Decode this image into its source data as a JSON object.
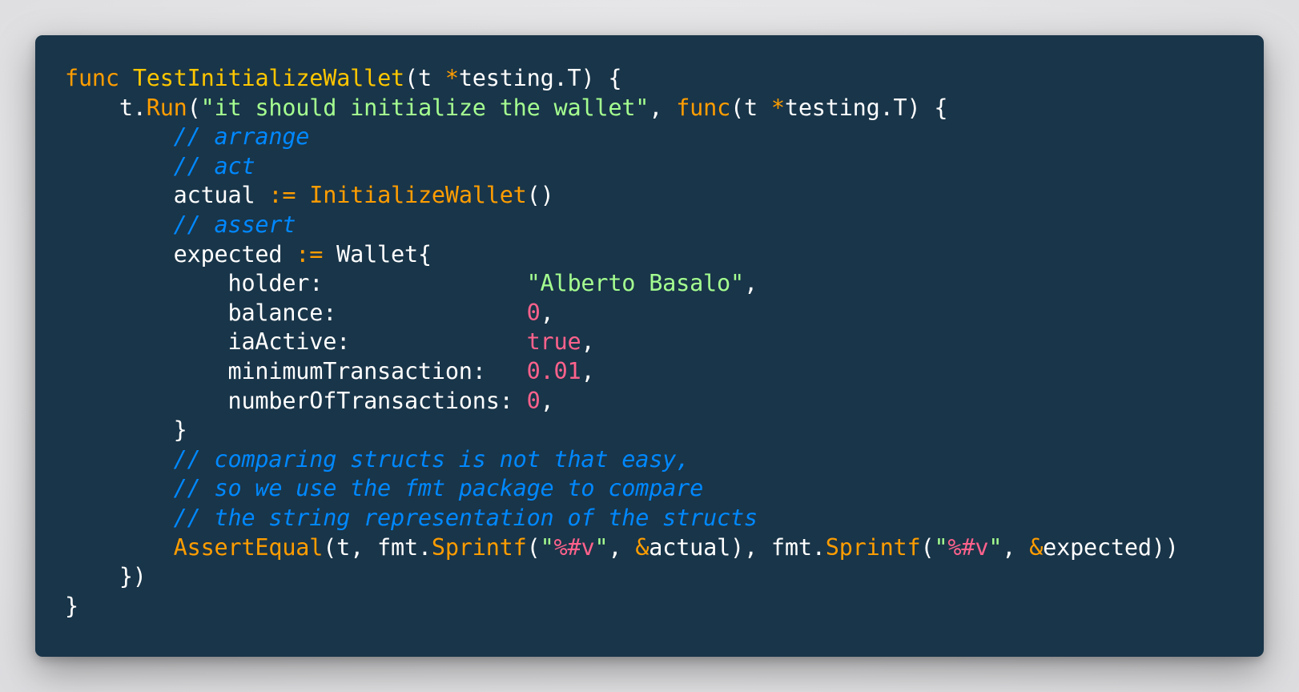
{
  "colors": {
    "background": "#193549",
    "keyword": "#ff9d00",
    "function_name": "#ffc600",
    "string": "#a5ff90",
    "number": "#ff628c",
    "comment": "#0088ff",
    "plain": "#ffffff"
  },
  "lines": [
    {
      "tokens": [
        {
          "t": "func",
          "c": "kw"
        },
        {
          "t": " ",
          "c": "pl"
        },
        {
          "t": "TestInitializeWallet",
          "c": "fn"
        },
        {
          "t": "(t ",
          "c": "pl"
        },
        {
          "t": "*",
          "c": "op"
        },
        {
          "t": "testing.T) {",
          "c": "pl"
        }
      ]
    },
    {
      "tokens": [
        {
          "t": "    t.",
          "c": "pl"
        },
        {
          "t": "Run",
          "c": "call"
        },
        {
          "t": "(",
          "c": "pl"
        },
        {
          "t": "\"it should initialize the wallet\"",
          "c": "str"
        },
        {
          "t": ", ",
          "c": "pl"
        },
        {
          "t": "func",
          "c": "kw"
        },
        {
          "t": "(t ",
          "c": "pl"
        },
        {
          "t": "*",
          "c": "op"
        },
        {
          "t": "testing.T) {",
          "c": "pl"
        }
      ]
    },
    {
      "tokens": [
        {
          "t": "        ",
          "c": "pl"
        },
        {
          "t": "// arrange",
          "c": "cm"
        }
      ]
    },
    {
      "tokens": [
        {
          "t": "        ",
          "c": "pl"
        },
        {
          "t": "// act",
          "c": "cm"
        }
      ]
    },
    {
      "tokens": [
        {
          "t": "        actual ",
          "c": "pl"
        },
        {
          "t": ":=",
          "c": "op"
        },
        {
          "t": " ",
          "c": "pl"
        },
        {
          "t": "InitializeWallet",
          "c": "call"
        },
        {
          "t": "()",
          "c": "pl"
        }
      ]
    },
    {
      "tokens": [
        {
          "t": "        ",
          "c": "pl"
        },
        {
          "t": "// assert",
          "c": "cm"
        }
      ]
    },
    {
      "tokens": [
        {
          "t": "        expected ",
          "c": "pl"
        },
        {
          "t": ":=",
          "c": "op"
        },
        {
          "t": " Wallet{",
          "c": "pl"
        }
      ]
    },
    {
      "tokens": [
        {
          "t": "            holder:               ",
          "c": "pl"
        },
        {
          "t": "\"Alberto Basalo\"",
          "c": "str"
        },
        {
          "t": ",",
          "c": "pl"
        }
      ]
    },
    {
      "tokens": [
        {
          "t": "            balance:              ",
          "c": "pl"
        },
        {
          "t": "0",
          "c": "num"
        },
        {
          "t": ",",
          "c": "pl"
        }
      ]
    },
    {
      "tokens": [
        {
          "t": "            iaActive:             ",
          "c": "pl"
        },
        {
          "t": "true",
          "c": "num"
        },
        {
          "t": ",",
          "c": "pl"
        }
      ]
    },
    {
      "tokens": [
        {
          "t": "            minimumTransaction:   ",
          "c": "pl"
        },
        {
          "t": "0.01",
          "c": "num"
        },
        {
          "t": ",",
          "c": "pl"
        }
      ]
    },
    {
      "tokens": [
        {
          "t": "            numberOfTransactions: ",
          "c": "pl"
        },
        {
          "t": "0",
          "c": "num"
        },
        {
          "t": ",",
          "c": "pl"
        }
      ]
    },
    {
      "tokens": [
        {
          "t": "        }",
          "c": "pl"
        }
      ]
    },
    {
      "tokens": [
        {
          "t": "        ",
          "c": "pl"
        },
        {
          "t": "// comparing structs is not that easy,",
          "c": "cm"
        }
      ]
    },
    {
      "tokens": [
        {
          "t": "        ",
          "c": "pl"
        },
        {
          "t": "// so we use the fmt package to compare",
          "c": "cm"
        }
      ]
    },
    {
      "tokens": [
        {
          "t": "        ",
          "c": "pl"
        },
        {
          "t": "// the string representation of the structs",
          "c": "cm"
        }
      ]
    },
    {
      "tokens": [
        {
          "t": "        ",
          "c": "pl"
        },
        {
          "t": "AssertEqual",
          "c": "call"
        },
        {
          "t": "(t, fmt.",
          "c": "pl"
        },
        {
          "t": "Sprintf",
          "c": "call"
        },
        {
          "t": "(",
          "c": "pl"
        },
        {
          "t": "\"",
          "c": "str"
        },
        {
          "t": "%#v",
          "c": "num"
        },
        {
          "t": "\"",
          "c": "str"
        },
        {
          "t": ", ",
          "c": "pl"
        },
        {
          "t": "&",
          "c": "op"
        },
        {
          "t": "actual), fmt.",
          "c": "pl"
        },
        {
          "t": "Sprintf",
          "c": "call"
        },
        {
          "t": "(",
          "c": "pl"
        },
        {
          "t": "\"",
          "c": "str"
        },
        {
          "t": "%#v",
          "c": "num"
        },
        {
          "t": "\"",
          "c": "str"
        },
        {
          "t": ", ",
          "c": "pl"
        },
        {
          "t": "&",
          "c": "op"
        },
        {
          "t": "expected))",
          "c": "pl"
        }
      ]
    },
    {
      "tokens": [
        {
          "t": "    })",
          "c": "pl"
        }
      ]
    },
    {
      "tokens": [
        {
          "t": "}",
          "c": "pl"
        }
      ]
    }
  ]
}
